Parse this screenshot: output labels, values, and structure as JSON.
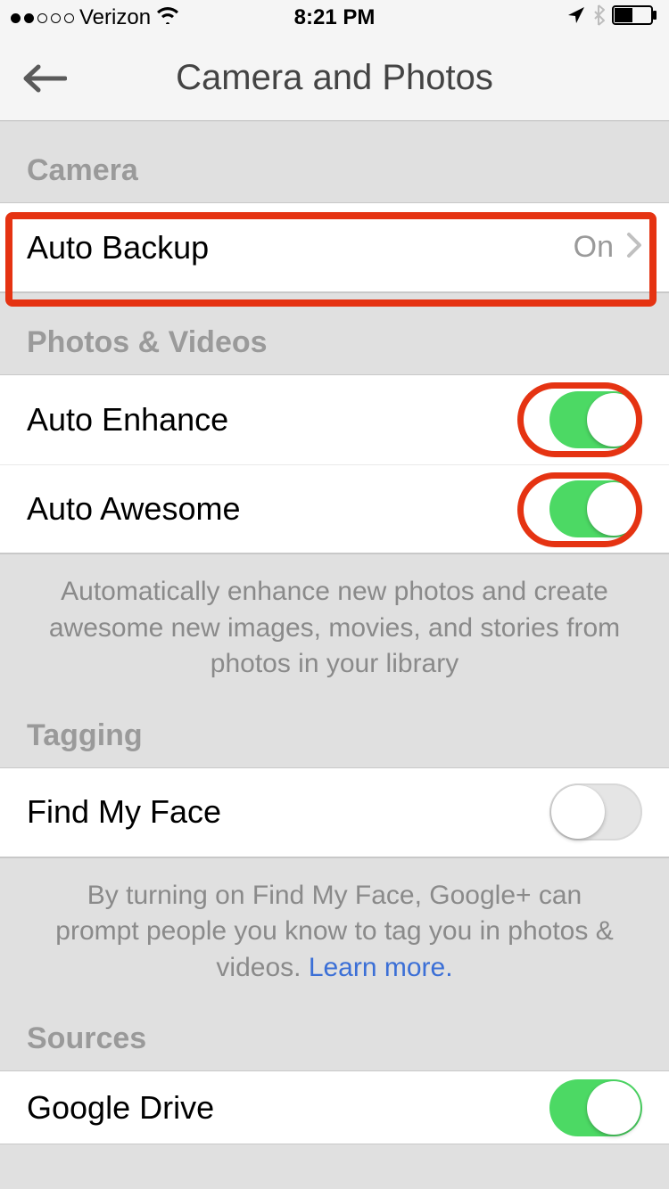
{
  "status": {
    "carrier": "Verizon",
    "time": "8:21 PM"
  },
  "nav": {
    "title": "Camera and Photos"
  },
  "sections": {
    "camera": {
      "header": "Camera",
      "auto_backup": {
        "label": "Auto Backup",
        "value": "On"
      }
    },
    "photos_videos": {
      "header": "Photos & Videos",
      "auto_enhance": {
        "label": "Auto Enhance",
        "on": true
      },
      "auto_awesome": {
        "label": "Auto Awesome",
        "on": true
      },
      "footer": "Automatically enhance new photos and create awesome new images, movies, and stories from photos in your library"
    },
    "tagging": {
      "header": "Tagging",
      "find_my_face": {
        "label": "Find My Face",
        "on": false
      },
      "footer_pre": "By turning on Find My Face, Google+ can prompt people you know to tag you in photos & videos. ",
      "footer_link": "Learn more."
    },
    "sources": {
      "header": "Sources",
      "google_drive": {
        "label": "Google Drive",
        "on": true
      }
    }
  }
}
